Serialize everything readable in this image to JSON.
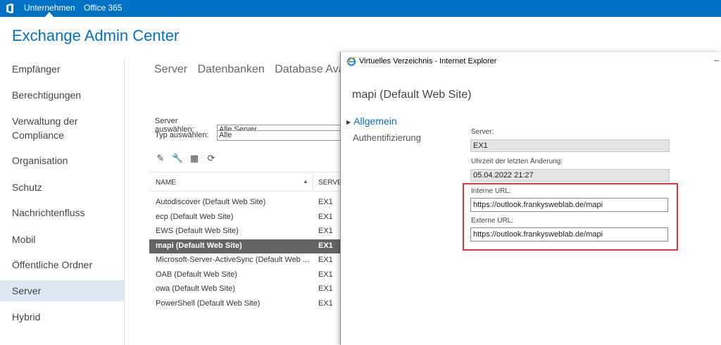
{
  "topbar": {
    "nav": [
      "Unternehmen",
      "Office 365"
    ]
  },
  "page_title": "Exchange Admin Center",
  "leftnav": {
    "items": [
      "Empfänger",
      "Berechtigungen",
      "Verwaltung der",
      "Compliance",
      "Organisation",
      "Schutz",
      "Nachrichtenfluss",
      "Mobil",
      "Öffentliche Ordner",
      "Server",
      "Hybrid"
    ],
    "selected": "Server"
  },
  "tabs": [
    "Server",
    "Datenbanken",
    "Database Avail"
  ],
  "filters": {
    "server_label": "Server auswählen:",
    "server_value": "Alle Server",
    "type_label": "Typ auswählen:",
    "type_value": "Alle"
  },
  "toolbar_icons": [
    "edit-icon",
    "wrench-icon",
    "certificate-icon",
    "refresh-icon"
  ],
  "grid": {
    "columns": [
      "NAME",
      "SERVER"
    ],
    "rows": [
      {
        "name": "Autodiscover (Default Web Site)",
        "server": "EX1"
      },
      {
        "name": "ecp (Default Web Site)",
        "server": "EX1"
      },
      {
        "name": "EWS (Default Web Site)",
        "server": "EX1"
      },
      {
        "name": "mapi (Default Web Site)",
        "server": "EX1",
        "selected": true
      },
      {
        "name": "Microsoft-Server-ActiveSync (Default Web ...",
        "server": "EX1"
      },
      {
        "name": "OAB (Default Web Site)",
        "server": "EX1"
      },
      {
        "name": "owa (Default Web Site)",
        "server": "EX1"
      },
      {
        "name": "PowerShell (Default Web Site)",
        "server": "EX1"
      }
    ]
  },
  "popup": {
    "window_title": "Virtuelles Verzeichnis - Internet Explorer",
    "dialog_title": "mapi (Default Web Site)",
    "nav_active": "Allgemein",
    "nav_other": "Authentifizierung",
    "fields": {
      "server_label": "Server:",
      "server_value": "EX1",
      "modified_label": "Uhrzeit der letzten Änderung:",
      "modified_value": "05.04.2022 21:27",
      "internal_label": "Interne URL:",
      "internal_value": "https://outlook.frankysweblab.de/mapi",
      "external_label": "Externe URL:",
      "external_value": "https://outlook.frankysweblab.de/mapi"
    }
  },
  "colors": {
    "accent": "#0072c6",
    "highlight": "#e0383e",
    "selected_row": "#646464"
  }
}
